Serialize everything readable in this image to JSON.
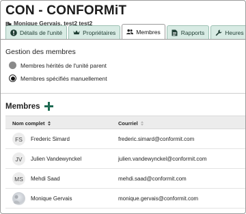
{
  "header": {
    "title": "CON - CONFORMiT",
    "subtitle": "Monique Gervais, test2 test2"
  },
  "tabs": [
    {
      "label": "Détails de l'unité",
      "icon": "exclamation-circle-icon"
    },
    {
      "label": "Propriétaires",
      "icon": "crown-icon"
    },
    {
      "label": "Membres",
      "icon": "users-icon",
      "active": true
    },
    {
      "label": "Rapports",
      "icon": "document-icon"
    },
    {
      "label": "Heures travaillées",
      "icon": "wrench-icon"
    }
  ],
  "members_management": {
    "title": "Gestion des membres",
    "options": [
      {
        "label": "Membres hérités de l'unité parent",
        "selected": false
      },
      {
        "label": "Membres spécifiés manuellement",
        "selected": true
      }
    ]
  },
  "members": {
    "title": "Membres",
    "columns": {
      "name": "Nom complet",
      "email": "Courriel"
    },
    "rows": [
      {
        "initials": "FS",
        "name": "Frederic Simard",
        "email": "frederic.simard@conformit.com"
      },
      {
        "initials": "JV",
        "name": "Julien Vandewynckel",
        "email": "julien.vandewynckel@conformit.com"
      },
      {
        "initials": "MS",
        "name": "Mehdi Saad",
        "email": "mehdi.saad@conformit.com"
      },
      {
        "initials": "",
        "name": "Monique Gervais",
        "email": "monique.gervais@conformit.com"
      }
    ]
  },
  "colors": {
    "accent": "#1e6b52",
    "tab_bg": "#d8ebe4",
    "header_row_bg": "#ececec"
  }
}
